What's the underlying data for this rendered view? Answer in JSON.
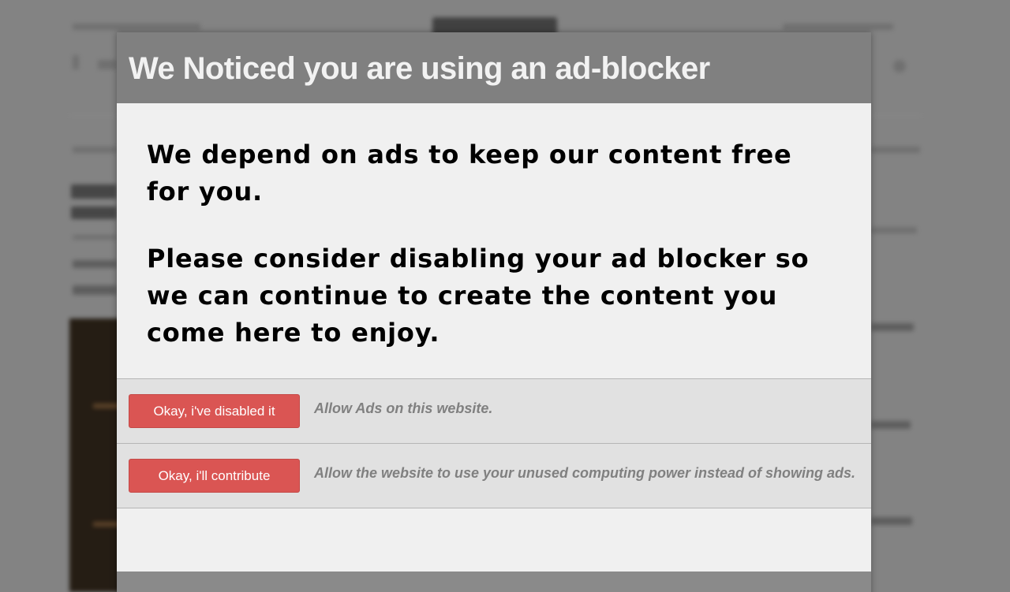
{
  "modal": {
    "title": "We Noticed you are using an ad-blocker",
    "message_1": "We depend on ads to keep our content free for you.",
    "message_2": "Please consider disabling your ad blocker so we can continue to create the content you come here to enjoy.",
    "options": [
      {
        "button_label": "Okay, i've disabled it",
        "description": "Allow Ads on this website."
      },
      {
        "button_label": "Okay, i'll contribute",
        "description": "Allow the website to use your unused computing power instead of showing ads."
      }
    ]
  },
  "colors": {
    "overlay": "#808080",
    "header_bg": "#808080",
    "button_bg": "#da5553",
    "row_bg": "#e1e1e1",
    "body_bg": "#f0f0f0"
  }
}
